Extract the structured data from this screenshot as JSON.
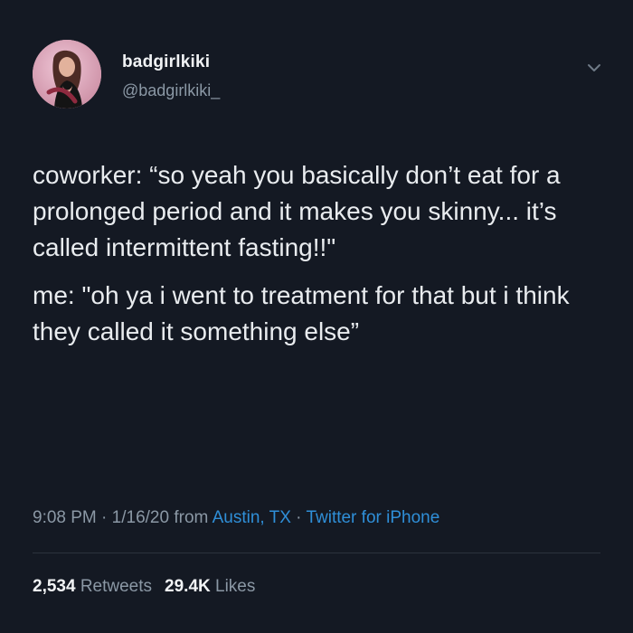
{
  "user": {
    "display_name": "badgirlkiki",
    "handle": "@badgirlkiki_"
  },
  "tweet": {
    "paragraph_1": "coworker: “so yeah you basically don’t eat for a prolonged period and it makes you skinny... it’s called intermittent fasting!!\"",
    "paragraph_2": "me: \"oh ya i went to treatment for that but i think they called it something else”"
  },
  "meta": {
    "time": "9:08 PM",
    "separator_1": " · ",
    "date": "1/16/20",
    "from_text": " from ",
    "location": "Austin, TX",
    "separator_2": " · ",
    "source": "Twitter for iPhone"
  },
  "stats": {
    "retweets_count": "2,534",
    "retweets_label": "Retweets",
    "likes_count": "29.4K",
    "likes_label": "Likes"
  },
  "icons": {
    "avatar": "profile-photo",
    "chevron": "chevron-down-icon"
  },
  "colors": {
    "background": "#141923",
    "text": "#e9ecef",
    "muted": "#8b98a5",
    "link": "#2f8fd8"
  }
}
